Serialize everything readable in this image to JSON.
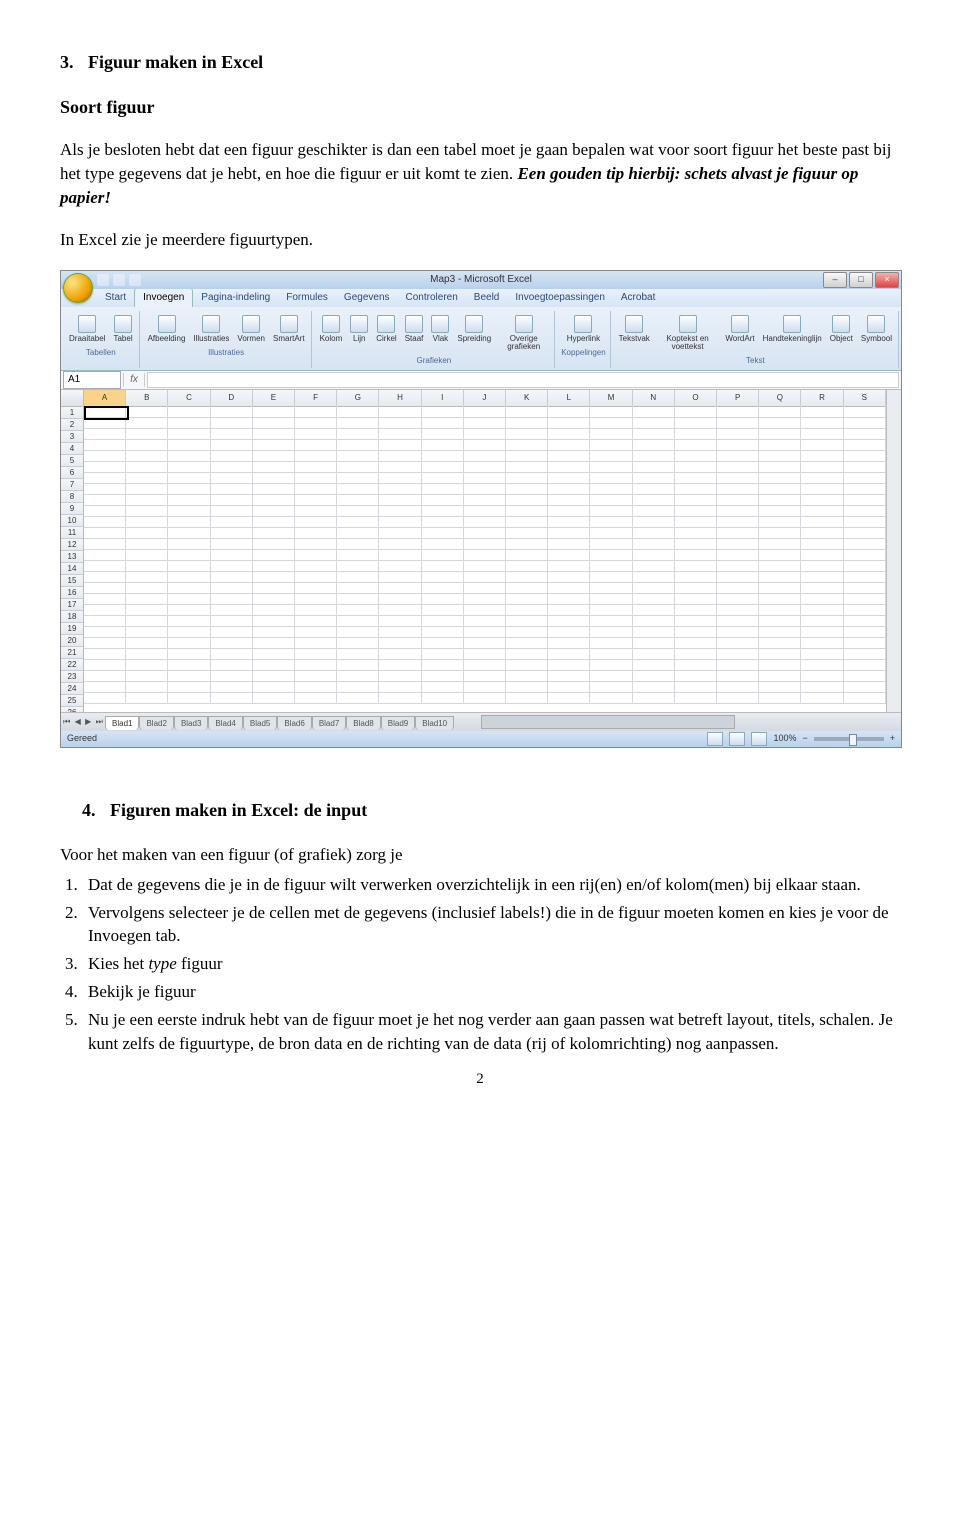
{
  "sec3": {
    "num": "3.",
    "title": "Figuur maken in Excel",
    "sub": "Soort figuur",
    "para1a": "Als je besloten hebt dat een figuur geschikter is dan een tabel moet je gaan bepalen wat voor soort figuur het beste past bij het type gegevens dat je hebt, en hoe die figuur er uit komt te zien. ",
    "para1b": "Een gouden tip hierbij: schets alvast je figuur op papier!",
    "para2": "In  Excel zie je meerdere figuurtypen."
  },
  "excel": {
    "title": "Map3 - Microsoft Excel",
    "tabs": [
      "Start",
      "Invoegen",
      "Pagina-indeling",
      "Formules",
      "Gegevens",
      "Controleren",
      "Beeld",
      "Invoegtoepassingen",
      "Acrobat"
    ],
    "activeTab": 1,
    "groups": [
      {
        "label": "Tabellen",
        "items": [
          "Draaitabel",
          "Tabel"
        ]
      },
      {
        "label": "Illustraties",
        "items": [
          "Afbeelding",
          "Illustraties",
          "Vormen",
          "SmartArt"
        ]
      },
      {
        "label": "Grafieken",
        "items": [
          "Kolom",
          "Lijn",
          "Cirkel",
          "Staaf",
          "Vlak",
          "Spreiding",
          "Overige grafieken"
        ]
      },
      {
        "label": "Koppelingen",
        "items": [
          "Hyperlink"
        ]
      },
      {
        "label": "Tekst",
        "items": [
          "Tekstvak",
          "Koptekst en voettekst",
          "WordArt",
          "Handtekeninglijn",
          "Object",
          "Symbool"
        ]
      }
    ],
    "namebox": "A1",
    "fx": "fx",
    "cols": [
      "A",
      "B",
      "C",
      "D",
      "E",
      "F",
      "G",
      "H",
      "I",
      "J",
      "K",
      "L",
      "M",
      "N",
      "O",
      "P",
      "Q",
      "R",
      "S"
    ],
    "rows": 27,
    "sheets": [
      "Blad1",
      "Blad2",
      "Blad3",
      "Blad4",
      "Blad5",
      "Blad6",
      "Blad7",
      "Blad8",
      "Blad9",
      "Blad10"
    ],
    "status": "Gereed",
    "zoom": "100%"
  },
  "sec4": {
    "num": "4.",
    "title": "Figuren maken in Excel: de input",
    "intro": "Voor het maken van een figuur (of grafiek) zorg je",
    "items": [
      "Dat de gegevens die je in de figuur wilt verwerken overzichtelijk in een rij(en) en/of kolom(men) bij elkaar staan.",
      "Vervolgens selecteer je de cellen met de gegevens (inclusief labels!) die in de figuur moeten komen en kies je voor de Invoegen tab.",
      "Kies het type figuur",
      "Bekijk je figuur",
      "Nu je een eerste indruk hebt van de figuur moet je het nog verder aan gaan passen wat betreft layout, titels, schalen. Je kunt zelfs de figuurtype, de bron data en de richting van de data (rij of kolomrichting) nog aanpassen."
    ],
    "item3_italic": "type"
  },
  "pagenum": "2"
}
